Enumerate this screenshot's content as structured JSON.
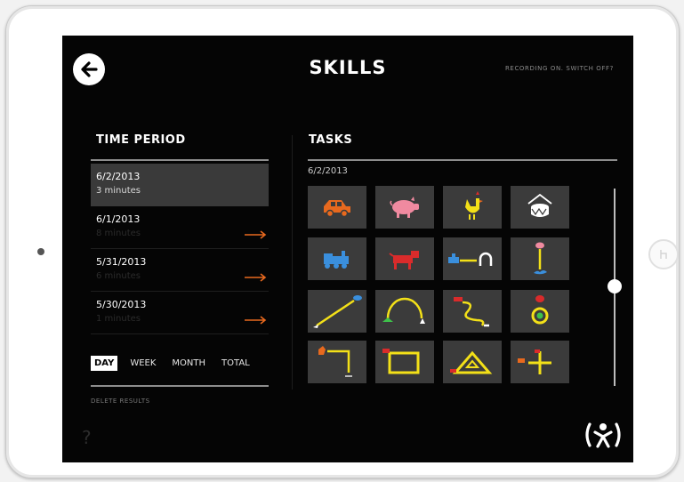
{
  "header": {
    "title": "SKILLS",
    "recording": "RECORDING ON. SWITCH OFF?",
    "back_icon": "arrow-left-circle-icon"
  },
  "time_period": {
    "heading": "TIME PERIOD",
    "items": [
      {
        "date": "6/2/2013",
        "duration": "3 minutes",
        "selected": true
      },
      {
        "date": "6/1/2013",
        "duration": "8 minutes",
        "selected": false
      },
      {
        "date": "5/31/2013",
        "duration": "6 minutes",
        "selected": false
      },
      {
        "date": "5/30/2013",
        "duration": "1 minutes",
        "selected": false
      }
    ],
    "arrow_color": "#e8691e",
    "ranges": [
      "DAY",
      "WEEK",
      "MONTH",
      "TOTAL"
    ],
    "active_range": "DAY",
    "delete_label": "DELETE RESULTS",
    "help_label": "?"
  },
  "tasks": {
    "heading": "TASKS",
    "date": "6/2/2013",
    "tiles": [
      {
        "icon": "car-icon"
      },
      {
        "icon": "pig-icon"
      },
      {
        "icon": "rooster-icon"
      },
      {
        "icon": "drum-icon"
      },
      {
        "icon": "train-icon"
      },
      {
        "icon": "dog-icon"
      },
      {
        "icon": "train-to-tunnel-icon"
      },
      {
        "icon": "pig-to-water-icon"
      },
      {
        "icon": "rocket-line-icon"
      },
      {
        "icon": "frog-jump-arc-icon"
      },
      {
        "icon": "dog-curvy-path-icon"
      },
      {
        "icon": "ladybug-ring-icon"
      },
      {
        "icon": "cat-corner-path-icon"
      },
      {
        "icon": "dog-rectangle-icon"
      },
      {
        "icon": "triangle-path-icon"
      },
      {
        "icon": "plus-path-icon"
      }
    ]
  },
  "scroll": {
    "position": 0.45
  },
  "logo_icon": "person-logo-icon",
  "colors": {
    "background": "#050505",
    "tile": "#3b3b3b",
    "yellow": "#f3e018",
    "orange": "#e8691e",
    "blue": "#3a8fdd",
    "red": "#d92b2b",
    "pink": "#f08aa0"
  }
}
